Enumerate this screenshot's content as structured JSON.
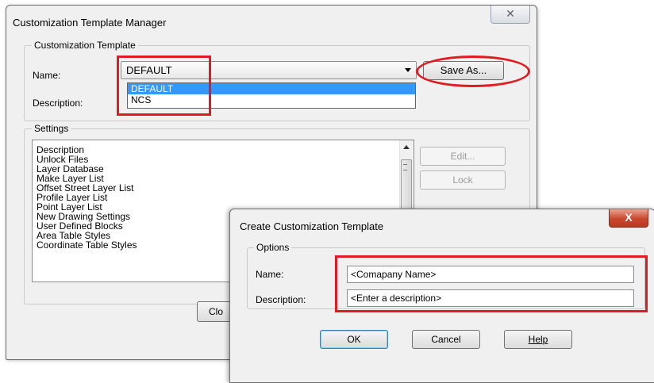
{
  "manager_dialog": {
    "title": "Customization Template Manager",
    "close_glyph": "✕",
    "group_template": {
      "label": "Customization Template",
      "name_label": "Name:",
      "description_label": "Description:",
      "name_selected": "DEFAULT",
      "name_options": [
        "DEFAULT",
        "NCS"
      ],
      "save_as_label": "Save As..."
    },
    "group_settings": {
      "label": "Settings",
      "items": [
        "Description",
        "Unlock Files",
        "Layer Database",
        "Make Layer List",
        "Offset Street Layer List",
        "Profile Layer List",
        "Point Layer List",
        "New Drawing Settings",
        "User Defined Blocks",
        "Area Table Styles",
        "Coordinate Table Styles"
      ],
      "edit_label": "Edit...",
      "lock_label": "Lock"
    },
    "close_label_partial": "Clo"
  },
  "create_dialog": {
    "title": "Create Customization Template",
    "close_glyph": "X",
    "options_label": "Options",
    "name_label": "Name:",
    "name_value": "<Comapany Name>",
    "description_label": "Description:",
    "description_value": "<Enter a description>",
    "ok_label": "OK",
    "cancel_label": "Cancel",
    "help_label": "Help"
  },
  "colors": {
    "annotation_red": "#e11b22",
    "selection_blue": "#3399ff"
  }
}
